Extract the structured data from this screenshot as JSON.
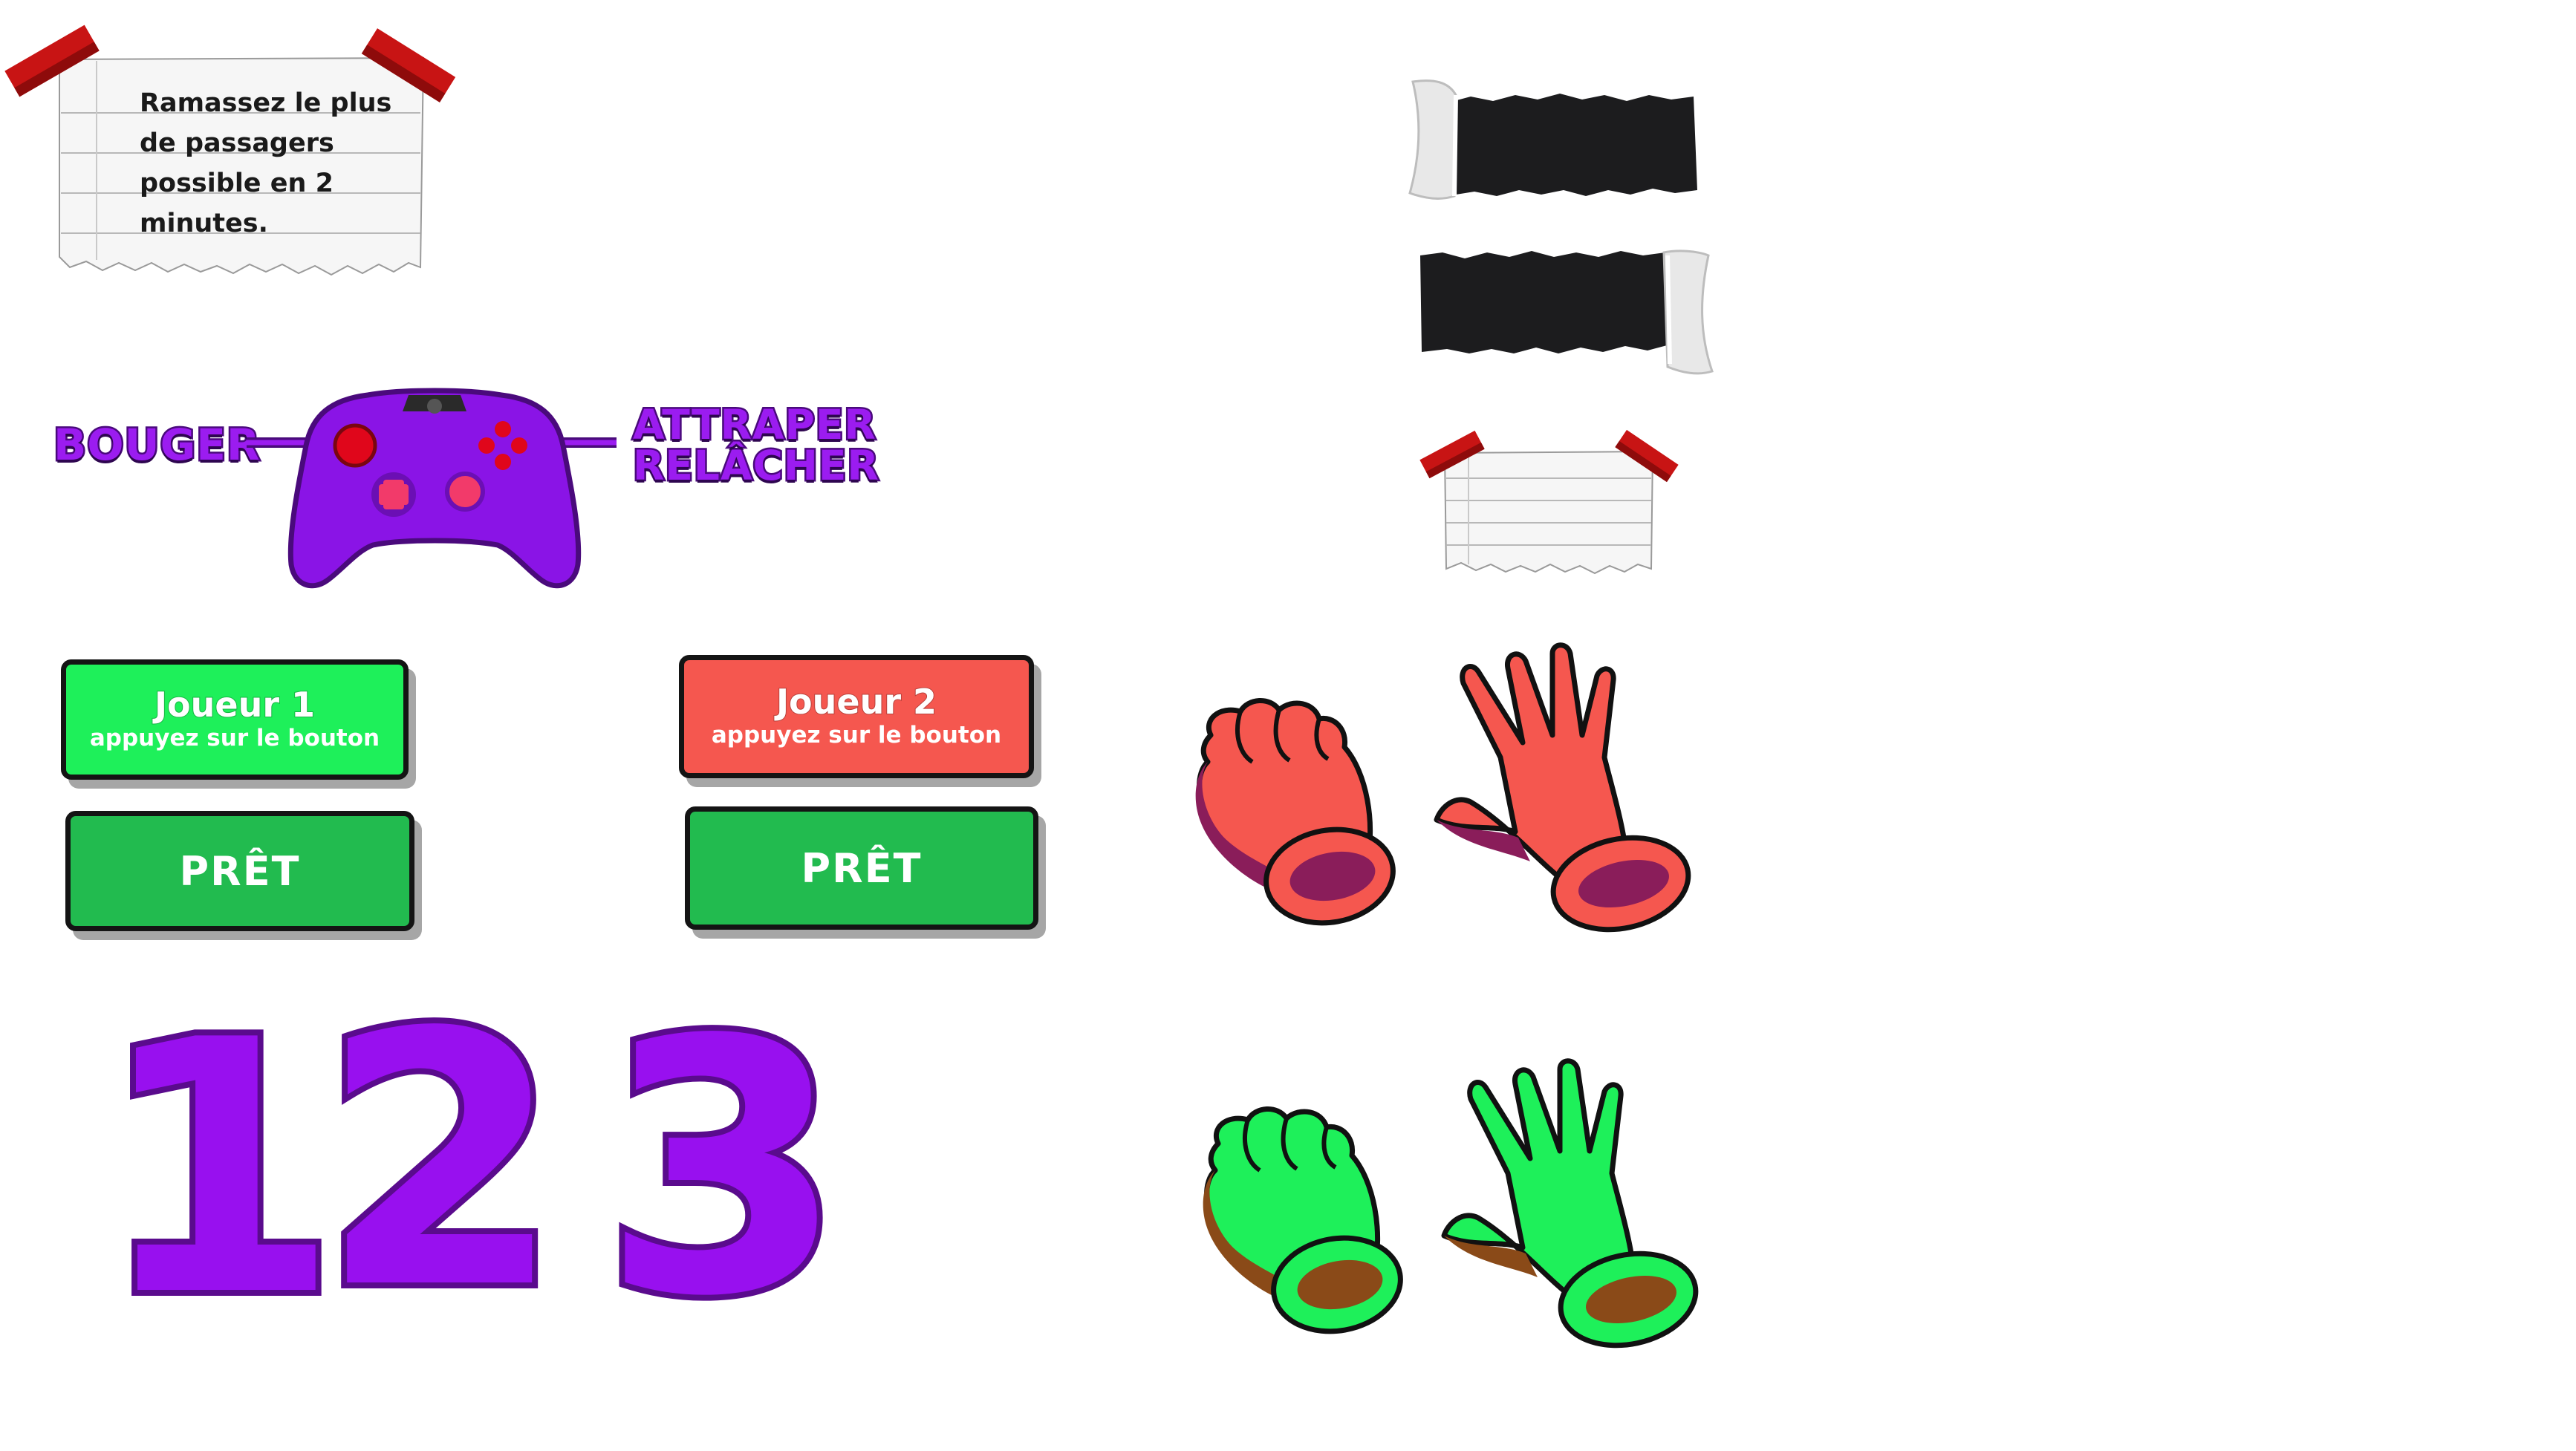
{
  "note": {
    "text": "Ramassez le plus de passagers possible en 2 minutes."
  },
  "controller": {
    "left_label": "BOUGER",
    "right_label_1": "ATTRAPER",
    "right_label_2": "RELÂCHER",
    "body_color": "#8a14e6"
  },
  "player1": {
    "title": "Joueur 1",
    "subtitle": "appuyez sur le bouton",
    "color": "#1ef05a"
  },
  "player2": {
    "title": "Joueur 2",
    "subtitle": "appuyez sur le bouton",
    "color": "#f5574f"
  },
  "ready": {
    "label_1": "PRÊT",
    "label_2": "PRÊT",
    "color": "#22bb4f"
  },
  "countdown": {
    "d1": "1",
    "d2": "2",
    "d3": "3"
  },
  "gloves": {
    "red_color": "#f5574f",
    "green_color": "#1ef05a"
  }
}
